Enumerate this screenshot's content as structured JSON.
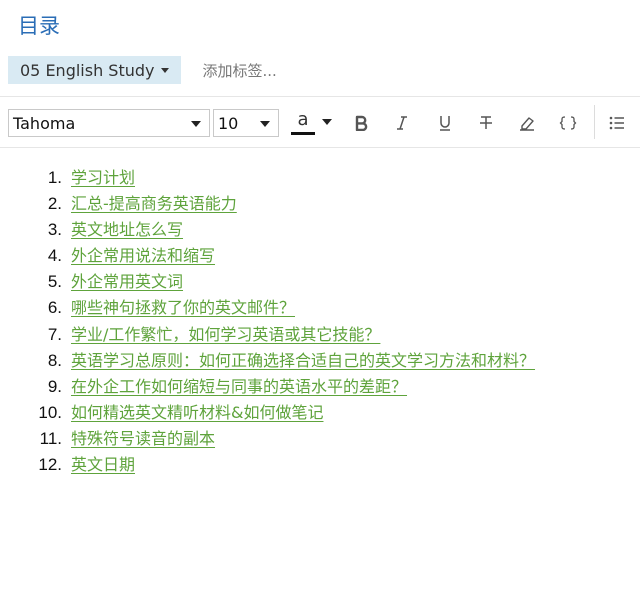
{
  "page": {
    "title": "目录"
  },
  "tags": {
    "notebook": "05 English Study",
    "add_placeholder": "添加标签..."
  },
  "toolbar": {
    "font": "Tahoma",
    "size": "10",
    "color_glyph": "a",
    "icons": [
      "bold-icon",
      "italic-icon",
      "underline-icon",
      "strikethrough-icon",
      "highlighter-icon",
      "code-block-icon",
      "list-icon"
    ],
    "colors": {
      "link": "#5ea33b",
      "title": "#2a6db6",
      "notebook_bg": "#d9eaf3"
    }
  },
  "toc": [
    {
      "num": "1.",
      "text": "学习计划"
    },
    {
      "num": "2.",
      "text": "汇总-提高商务英语能力"
    },
    {
      "num": "3.",
      "text": "英文地址怎么写"
    },
    {
      "num": "4.",
      "text": "外企常用说法和缩写"
    },
    {
      "num": "5.",
      "text": "外企常用英文词"
    },
    {
      "num": "6.",
      "text": "哪些神句拯救了你的英文邮件？"
    },
    {
      "num": "7.",
      "text": "学业/工作繁忙，如何学习英语或其它技能？"
    },
    {
      "num": "8.",
      "text": "英语学习总原则：如何正确选择合适自己的英文学习方法和材料？"
    },
    {
      "num": "9.",
      "text": "在外企工作如何缩短与同事的英语水平的差距？"
    },
    {
      "num": "10.",
      "text": "如何精选英文精听材料&如何做笔记"
    },
    {
      "num": "11.",
      "text": "特殊符号读音的副本"
    },
    {
      "num": "12.",
      "text": "英文日期"
    }
  ]
}
